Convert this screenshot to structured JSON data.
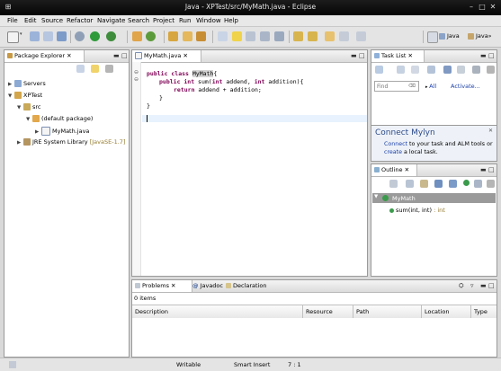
{
  "window": {
    "title": "Java - XPTest/src/MyMath.java - Eclipse"
  },
  "menu": [
    "File",
    "Edit",
    "Source",
    "Refactor",
    "Navigate",
    "Search",
    "Project",
    "Run",
    "Window",
    "Help"
  ],
  "perspectives": {
    "java": "Java",
    "javaee": "Java"
  },
  "package_explorer": {
    "tab_label": "Package Explorer",
    "tree": {
      "servers": "Servers",
      "project": "XPTest",
      "src": "src",
      "default_package": "(default package)",
      "file": "MyMath.java",
      "jre": "JRE System Library",
      "jre_version": "[JavaSE-1.7]"
    }
  },
  "editor": {
    "tab_label": "MyMath.java",
    "code": {
      "line1_kw": "public class ",
      "line1_name": "MyMath",
      "line1_rest": "{",
      "line2_kw": "public int ",
      "line2_rest1": "sum(",
      "line2_int1": "int",
      "line2_rest2": " addend, ",
      "line2_int2": "int",
      "line2_rest3": " addition){",
      "line3_kw": "return",
      "line3_rest": " addend + addition;",
      "line4": "}",
      "line5": "}"
    }
  },
  "task_list": {
    "tab_label": "Task List",
    "find_placeholder": "Find",
    "all_label": "All",
    "activate_label": "Activate..."
  },
  "mylyn": {
    "title": "Connect Mylyn",
    "line1_link": "Connect",
    "line1_rest": " to your task and ALM tools or",
    "line2_link": "create",
    "line2_rest": " a local task."
  },
  "outline": {
    "tab_label": "Outline",
    "class_name": "MyMath",
    "method": "sum(int, int)",
    "method_type": " : int"
  },
  "bottom": {
    "tabs": {
      "problems": "Problems",
      "javadoc": "Javadoc",
      "declaration": "Declaration"
    },
    "items": "0 items",
    "columns": [
      "Description",
      "Resource",
      "Path",
      "Location",
      "Type"
    ]
  },
  "statusbar": {
    "writable": "Writable",
    "insert_mode": "Smart Insert",
    "position": "7 : 1"
  }
}
